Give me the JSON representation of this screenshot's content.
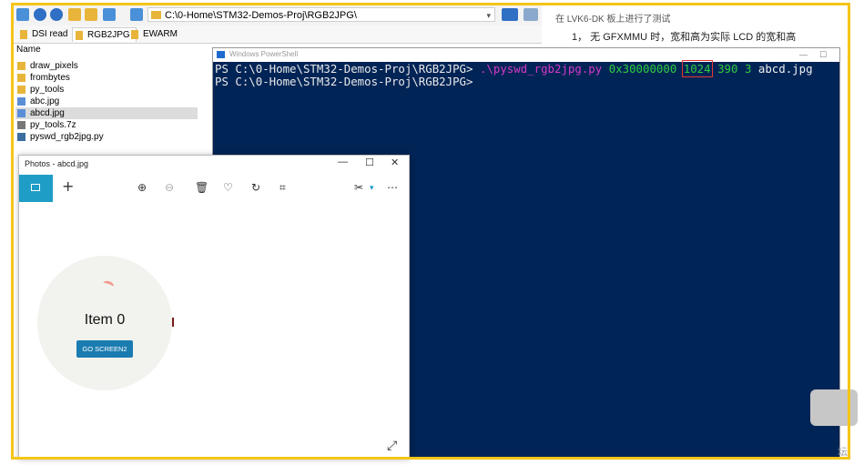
{
  "explorer": {
    "address": "C:\\0-Home\\STM32-Demos-Proj\\RGB2JPG\\",
    "tabs": [
      "DSI read",
      "RGB2JPG",
      "EWARM"
    ],
    "column_name": "Name",
    "files": [
      {
        "name": "draw_pixels",
        "type": "folder"
      },
      {
        "name": "frombytes",
        "type": "folder"
      },
      {
        "name": "py_tools",
        "type": "folder"
      },
      {
        "name": "abc.jpg",
        "type": "image"
      },
      {
        "name": "abcd.jpg",
        "type": "image",
        "selected": true
      },
      {
        "name": "py_tools.7z",
        "type": "archive"
      },
      {
        "name": "pyswd_rgb2jpg.py",
        "type": "python"
      }
    ]
  },
  "doc": {
    "line1": "在 LVK6-DK 板上进行了测试",
    "line2": "1，  无 GFXMMU 时，宽和高为实际 LCD 的宽和高"
  },
  "powershell": {
    "title": "Windows PowerShell",
    "prompt1": "PS C:\\0-Home\\STM32-Demos-Proj\\RGB2JPG> ",
    "cmd": ".\\pyswd_rgb2jpg.py",
    "arg_addr": "0x30000000",
    "arg_width": "1024",
    "arg_height": "390",
    "arg_mode": "3",
    "arg_file": "abcd.jpg",
    "prompt2": "PS C:\\0-Home\\STM32-Demos-Proj\\RGB2JPG>"
  },
  "photos": {
    "title": "Photos - abcd.jpg",
    "item_text": "Item 0",
    "button_text": "GO SCREEN2"
  },
  "watermark": "坛",
  "colors": {
    "frame": "#f5c518",
    "ps_bg": "#012456",
    "photos_accent": "#1e9dc7"
  }
}
